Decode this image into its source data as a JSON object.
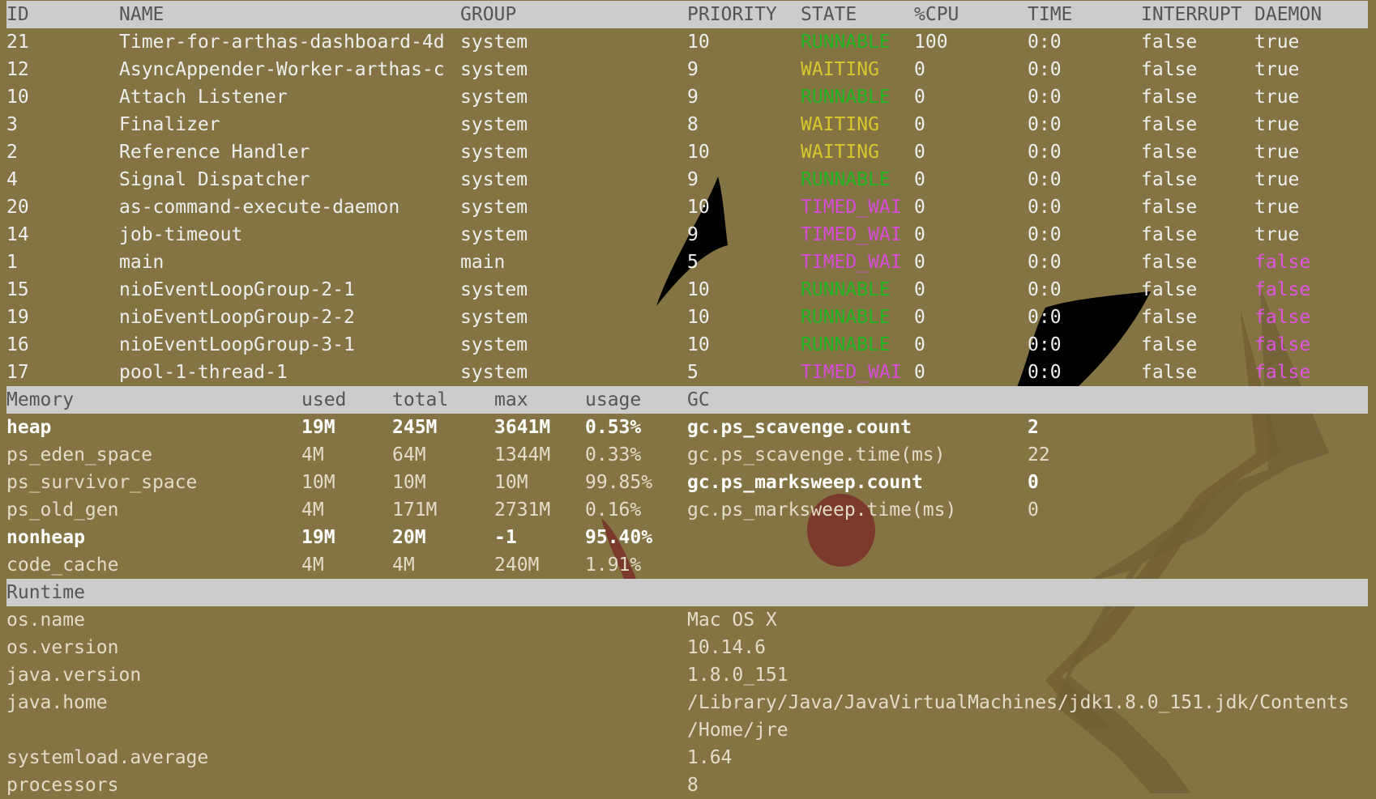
{
  "colors": {
    "background": "#847443",
    "header_bar": "#cccccc",
    "header_text": "#555555",
    "text": "#eeeeee",
    "runnable": "#22b622",
    "waiting": "#d6c82c",
    "timed_waiting": "#d64cd6",
    "daemon_false": "#e054e0"
  },
  "threads": {
    "headers": [
      "ID",
      "NAME",
      "GROUP",
      "PRIORITY",
      "STATE",
      "%CPU",
      "TIME",
      "INTERRUPT",
      "DAEMON"
    ],
    "rows": [
      {
        "id": "21",
        "name": "Timer-for-arthas-dashboard-4d",
        "group": "system",
        "priority": "10",
        "state": "RUNNABLE",
        "state_kind": "runnable",
        "cpu": "100",
        "time": "0:0",
        "interrupt": "false",
        "daemon": "true"
      },
      {
        "id": "12",
        "name": "AsyncAppender-Worker-arthas-c",
        "group": "system",
        "priority": "9",
        "state": "WAITING",
        "state_kind": "waiting",
        "cpu": "0",
        "time": "0:0",
        "interrupt": "false",
        "daemon": "true"
      },
      {
        "id": "10",
        "name": "Attach Listener",
        "group": "system",
        "priority": "9",
        "state": "RUNNABLE",
        "state_kind": "runnable",
        "cpu": "0",
        "time": "0:0",
        "interrupt": "false",
        "daemon": "true"
      },
      {
        "id": "3",
        "name": "Finalizer",
        "group": "system",
        "priority": "8",
        "state": "WAITING",
        "state_kind": "waiting",
        "cpu": "0",
        "time": "0:0",
        "interrupt": "false",
        "daemon": "true"
      },
      {
        "id": "2",
        "name": "Reference Handler",
        "group": "system",
        "priority": "10",
        "state": "WAITING",
        "state_kind": "waiting",
        "cpu": "0",
        "time": "0:0",
        "interrupt": "false",
        "daemon": "true"
      },
      {
        "id": "4",
        "name": "Signal Dispatcher",
        "group": "system",
        "priority": "9",
        "state": "RUNNABLE",
        "state_kind": "runnable",
        "cpu": "0",
        "time": "0:0",
        "interrupt": "false",
        "daemon": "true"
      },
      {
        "id": "20",
        "name": "as-command-execute-daemon",
        "group": "system",
        "priority": "10",
        "state": "TIMED_WAI",
        "state_kind": "timed",
        "cpu": "0",
        "time": "0:0",
        "interrupt": "false",
        "daemon": "true"
      },
      {
        "id": "14",
        "name": "job-timeout",
        "group": "system",
        "priority": "9",
        "state": "TIMED_WAI",
        "state_kind": "timed",
        "cpu": "0",
        "time": "0:0",
        "interrupt": "false",
        "daemon": "true"
      },
      {
        "id": "1",
        "name": "main",
        "group": "main",
        "priority": "5",
        "state": "TIMED_WAI",
        "state_kind": "timed",
        "cpu": "0",
        "time": "0:0",
        "interrupt": "false",
        "daemon": "false"
      },
      {
        "id": "15",
        "name": "nioEventLoopGroup-2-1",
        "group": "system",
        "priority": "10",
        "state": "RUNNABLE",
        "state_kind": "runnable",
        "cpu": "0",
        "time": "0:0",
        "interrupt": "false",
        "daemon": "false"
      },
      {
        "id": "19",
        "name": "nioEventLoopGroup-2-2",
        "group": "system",
        "priority": "10",
        "state": "RUNNABLE",
        "state_kind": "runnable",
        "cpu": "0",
        "time": "0:0",
        "interrupt": "false",
        "daemon": "false"
      },
      {
        "id": "16",
        "name": "nioEventLoopGroup-3-1",
        "group": "system",
        "priority": "10",
        "state": "RUNNABLE",
        "state_kind": "runnable",
        "cpu": "0",
        "time": "0:0",
        "interrupt": "false",
        "daemon": "false"
      },
      {
        "id": "17",
        "name": "pool-1-thread-1",
        "group": "system",
        "priority": "5",
        "state": "TIMED_WAI",
        "state_kind": "timed",
        "cpu": "0",
        "time": "0:0",
        "interrupt": "false",
        "daemon": "false"
      }
    ]
  },
  "memory": {
    "headers": [
      "Memory",
      "used",
      "total",
      "max",
      "usage",
      "GC"
    ],
    "rows": [
      {
        "name": "heap",
        "used": "19M",
        "total": "245M",
        "max": "3641M",
        "usage": "0.53%",
        "bold": true
      },
      {
        "name": "ps_eden_space",
        "used": "4M",
        "total": "64M",
        "max": "1344M",
        "usage": "0.33%",
        "bold": false
      },
      {
        "name": "ps_survivor_space",
        "used": "10M",
        "total": "10M",
        "max": "10M",
        "usage": "99.85%",
        "bold": false
      },
      {
        "name": "ps_old_gen",
        "used": "4M",
        "total": "171M",
        "max": "2731M",
        "usage": "0.16%",
        "bold": false
      },
      {
        "name": "nonheap",
        "used": "19M",
        "total": "20M",
        "max": "-1",
        "usage": "95.40%",
        "bold": true
      },
      {
        "name": "code_cache",
        "used": "4M",
        "total": "4M",
        "max": "240M",
        "usage": "1.91%",
        "bold": false
      }
    ],
    "gc": [
      {
        "name": "gc.ps_scavenge.count",
        "value": "2",
        "bold": true
      },
      {
        "name": "gc.ps_scavenge.time(ms)",
        "value": "22",
        "bold": false
      },
      {
        "name": "gc.ps_marksweep.count",
        "value": "0",
        "bold": true
      },
      {
        "name": "gc.ps_marksweep.time(ms)",
        "value": "0",
        "bold": false
      }
    ]
  },
  "runtime": {
    "header": "Runtime",
    "rows": [
      {
        "key": "os.name",
        "value": "Mac OS X"
      },
      {
        "key": "os.version",
        "value": "10.14.6"
      },
      {
        "key": "java.version",
        "value": "1.8.0_151"
      },
      {
        "key": "java.home",
        "value": "/Library/Java/JavaVirtualMachines/jdk1.8.0_151.jdk/Contents"
      },
      {
        "key": "",
        "value": "/Home/jre"
      },
      {
        "key": "systemload.average",
        "value": "1.64"
      },
      {
        "key": "processors",
        "value": "8"
      }
    ]
  }
}
